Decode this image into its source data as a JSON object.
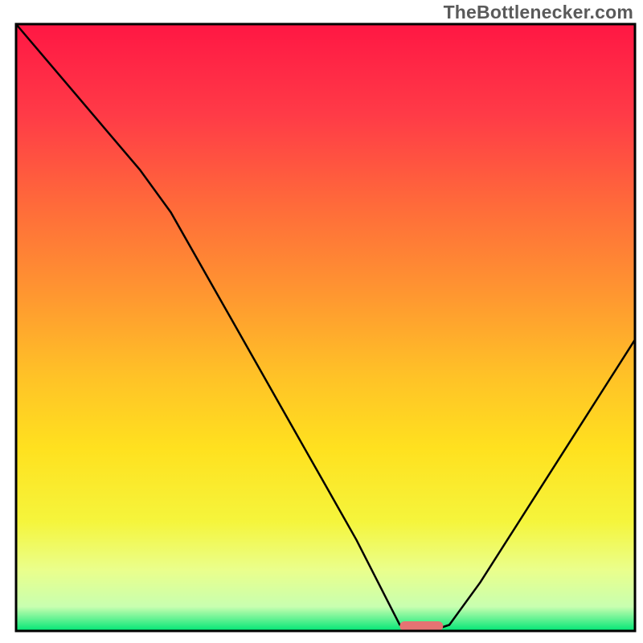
{
  "watermark": "TheBottlenecker.com",
  "chart_data": {
    "type": "line",
    "title": "",
    "xlabel": "",
    "ylabel": "",
    "xlim": [
      0,
      100
    ],
    "ylim": [
      0,
      100
    ],
    "x": [
      0,
      5,
      10,
      15,
      20,
      25,
      30,
      35,
      40,
      45,
      50,
      55,
      60,
      62,
      65,
      67,
      70,
      75,
      80,
      85,
      90,
      95,
      100
    ],
    "values": [
      100,
      94,
      88,
      82,
      76,
      69,
      60,
      51,
      42,
      33,
      24,
      15,
      5,
      1,
      0,
      0,
      1,
      8,
      16,
      24,
      32,
      40,
      48
    ],
    "series_name": "bottleneck-curve",
    "gradient_stops": [
      {
        "offset": 0.0,
        "color": "#ff1744"
      },
      {
        "offset": 0.15,
        "color": "#ff3b47"
      },
      {
        "offset": 0.3,
        "color": "#ff6b3a"
      },
      {
        "offset": 0.45,
        "color": "#ff9830"
      },
      {
        "offset": 0.58,
        "color": "#ffc227"
      },
      {
        "offset": 0.7,
        "color": "#ffe11f"
      },
      {
        "offset": 0.82,
        "color": "#f5f53c"
      },
      {
        "offset": 0.9,
        "color": "#eaff8c"
      },
      {
        "offset": 0.96,
        "color": "#c8ffb0"
      },
      {
        "offset": 1.0,
        "color": "#00e676"
      }
    ],
    "marker": {
      "x_start": 62,
      "x_end": 69,
      "y": 0,
      "color": "#e57373"
    },
    "plot_border_color": "#000000",
    "curve_color": "#000000"
  }
}
